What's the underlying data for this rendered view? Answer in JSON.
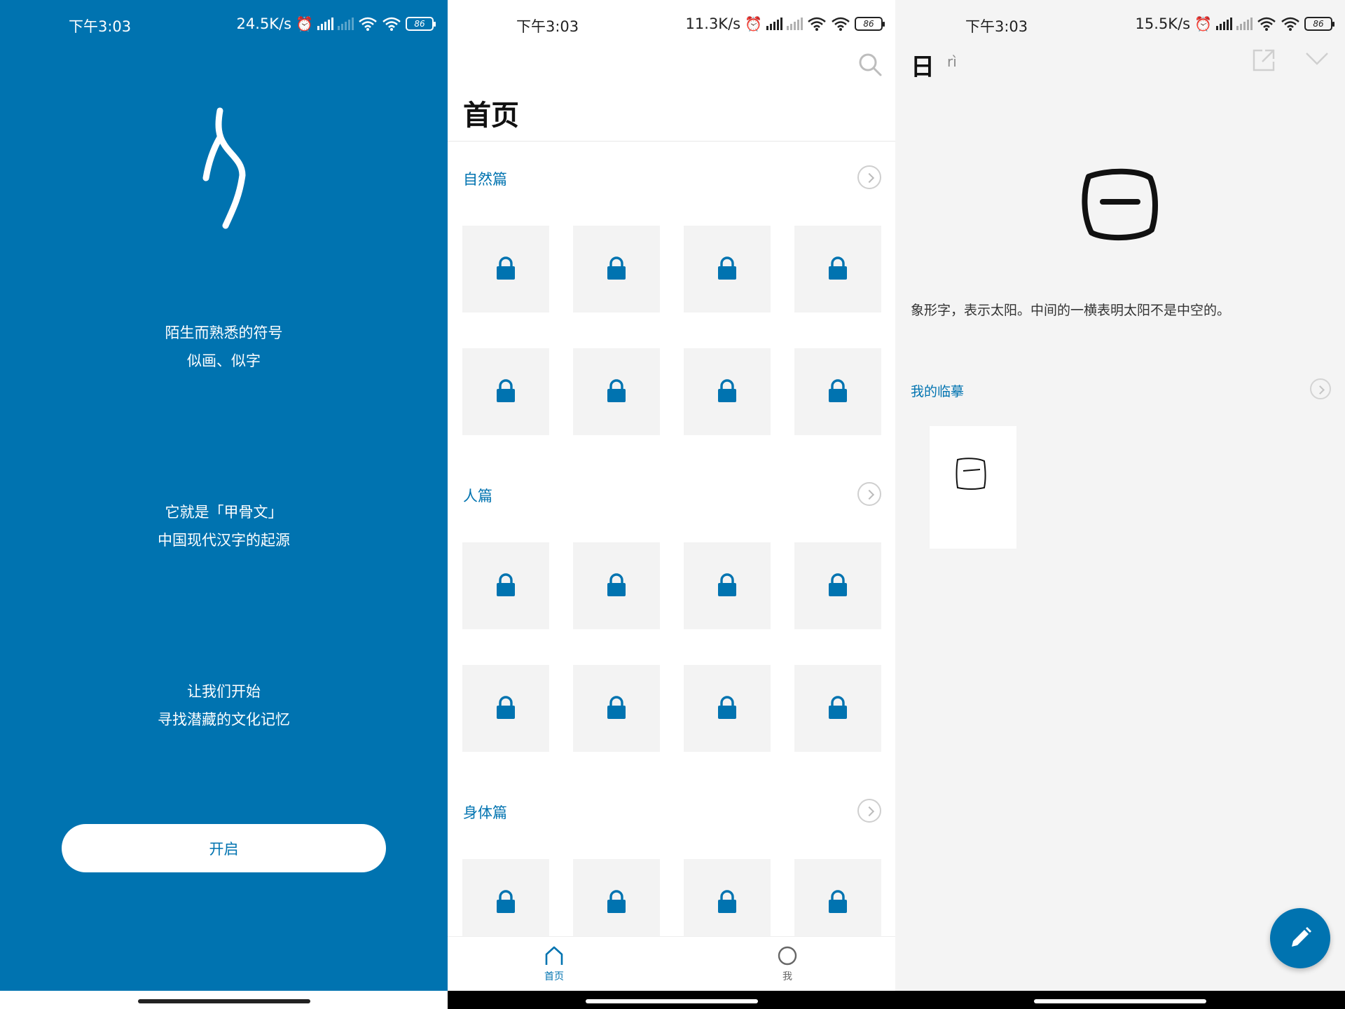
{
  "screens": {
    "intro": {
      "status": {
        "time": "下午3:03",
        "speed": "24.5K/s",
        "battery": "86"
      },
      "lines": [
        [
          "陌生而熟悉的符号",
          "似画、似字"
        ],
        [
          "它就是「甲骨文」",
          "中国现代汉字的起源"
        ],
        [
          "让我们开始",
          "寻找潜藏的文化记忆"
        ]
      ],
      "start_button": "开启"
    },
    "home": {
      "status": {
        "time": "下午3:03",
        "speed": "11.3K/s",
        "battery": "86"
      },
      "title": "首页",
      "sections": [
        {
          "title": "自然篇"
        },
        {
          "title": "人篇"
        },
        {
          "title": "身体篇"
        }
      ],
      "tabs": [
        {
          "label": "首页",
          "active": true
        },
        {
          "label": "我",
          "active": false
        }
      ],
      "tile_icon": "lock-icon"
    },
    "detail": {
      "status": {
        "time": "下午3:03",
        "speed": "15.5K/s",
        "battery": "86"
      },
      "character": "日",
      "pinyin": "rì",
      "description": "象形字，表示太阳。中间的一横表明太阳不是中空的。",
      "copies_title": "我的临摹"
    }
  },
  "colors": {
    "brand": "#0073b0",
    "tile_bg": "#f3f3f3",
    "detail_bg": "#f4f4f4"
  }
}
